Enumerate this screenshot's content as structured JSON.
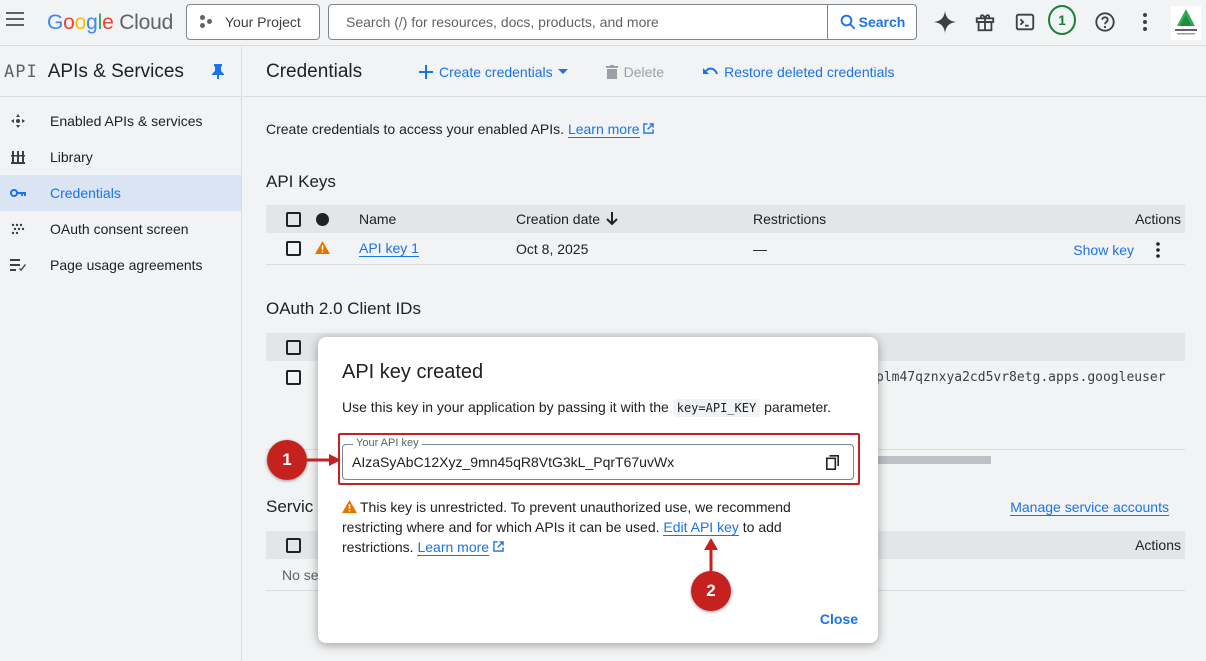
{
  "topbar": {
    "logo_google": "Google",
    "logo_cloud": "Cloud",
    "project": "Your Project",
    "search_placeholder": "Search (/) for resources, docs, products, and more",
    "search_button": "Search",
    "notification_count": "1"
  },
  "sidebar": {
    "api_label": "API",
    "title": "APIs & Services",
    "items": [
      {
        "label": "Enabled APIs & services"
      },
      {
        "label": "Library"
      },
      {
        "label": "Credentials"
      },
      {
        "label": "OAuth consent screen"
      },
      {
        "label": "Page usage agreements"
      }
    ]
  },
  "toolbar": {
    "title": "Credentials",
    "create": "Create credentials",
    "delete": "Delete",
    "restore": "Restore deleted credentials"
  },
  "intro": {
    "text": "Create credentials to access your enabled APIs.",
    "link": "Learn more"
  },
  "api_keys": {
    "title": "API Keys",
    "headers": {
      "name": "Name",
      "created": "Creation date",
      "restrictions": "Restrictions",
      "actions": "Actions"
    },
    "rows": [
      {
        "name": "API key 1",
        "created": "Oct 8, 2025",
        "restrictions": "—",
        "action": "Show key"
      }
    ]
  },
  "oauth": {
    "title": "OAuth 2.0 Client IDs",
    "client_id_fragment": "plm47qznxya2cd5vr8etg.apps.googleuser"
  },
  "service": {
    "title_fragment": "Servic",
    "manage_link": "Manage service accounts",
    "actions_header": "Actions",
    "empty_fragment": "No se"
  },
  "modal": {
    "title": "API key created",
    "desc_before": "Use this key in your application by passing it with the",
    "desc_code": "key=API_KEY",
    "desc_after": "parameter.",
    "field_label": "Your API key",
    "key_value": "AIzaSyAbC12Xyz_9mn45qR8VtG3kL_PqrT67uvWx",
    "warn_1": "This key is unrestricted. To prevent unauthorized use, we recommend restricting where and for which APIs it can be used.",
    "warn_link": "Edit API key",
    "warn_2": "to add restrictions.",
    "learn_more": "Learn more",
    "close": "Close"
  },
  "annotations": {
    "marker_1": "1",
    "marker_2": "2"
  },
  "colors": {
    "accent": "#1a73e8",
    "annotation_red": "#c5221f",
    "warning": "#e37400"
  }
}
